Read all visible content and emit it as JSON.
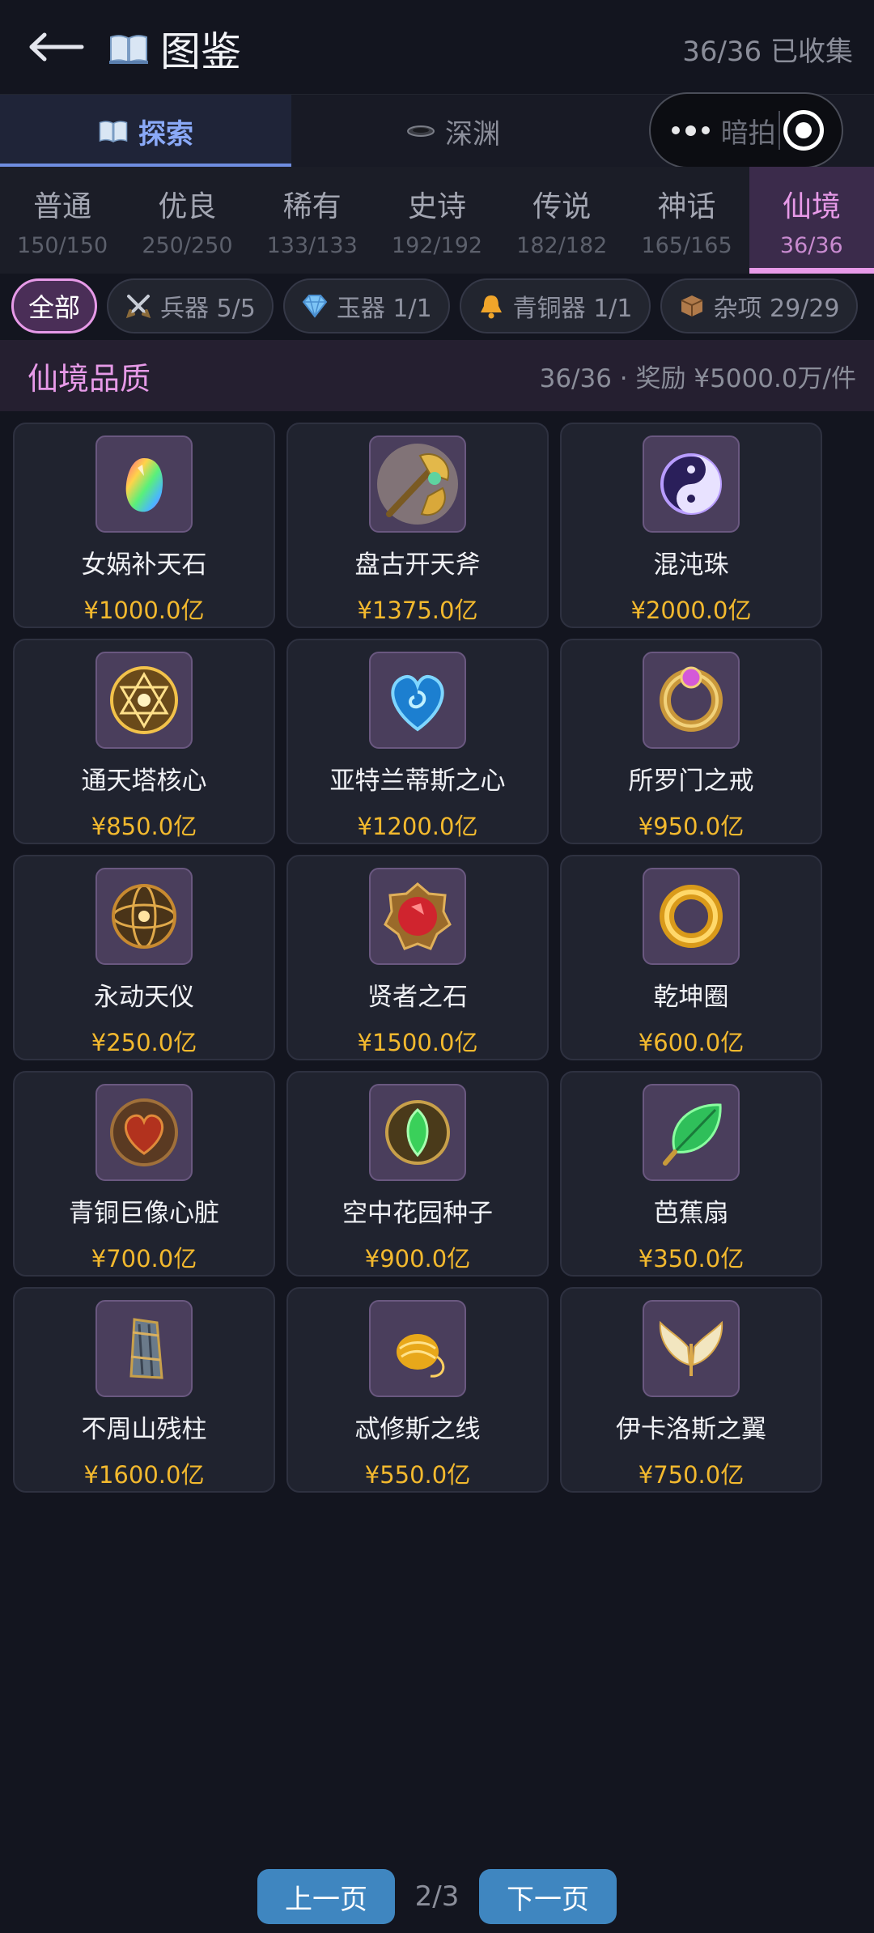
{
  "header": {
    "title": "图鉴",
    "collected": "36/36 已收集",
    "icons": {
      "back": "back-arrow-icon",
      "title": "book-icon"
    }
  },
  "tabs": [
    {
      "label": "探索",
      "active": true,
      "icon": "book-icon"
    },
    {
      "label": "深渊",
      "active": false,
      "icon": "abyss-disc-icon"
    }
  ],
  "capsule": {
    "label": "暗拍",
    "icons": [
      "more-dots-icon",
      "target-icon"
    ]
  },
  "rarities": [
    {
      "name": "普通",
      "count": "150/150",
      "active": false
    },
    {
      "name": "优良",
      "count": "250/250",
      "active": false
    },
    {
      "name": "稀有",
      "count": "133/133",
      "active": false
    },
    {
      "name": "史诗",
      "count": "192/192",
      "active": false
    },
    {
      "name": "传说",
      "count": "182/182",
      "active": false
    },
    {
      "name": "神话",
      "count": "165/165",
      "active": false
    },
    {
      "name": "仙境",
      "count": "36/36",
      "active": true
    }
  ],
  "chips": [
    {
      "label": "全部",
      "active": true,
      "icon": ""
    },
    {
      "label": "兵器 5/5",
      "active": false,
      "icon": "crossed-swords-icon"
    },
    {
      "label": "玉器 1/1",
      "active": false,
      "icon": "gem-icon"
    },
    {
      "label": "青铜器 1/1",
      "active": false,
      "icon": "bell-icon"
    },
    {
      "label": "杂项 29/29",
      "active": false,
      "icon": "box-icon"
    }
  ],
  "section": {
    "title": "仙境品质",
    "meta": "36/36 · 奖励 ¥5000.0万/件"
  },
  "items": [
    {
      "name": "女娲补天石",
      "price": "¥1000.0亿",
      "icon": "rainbow-stone-icon"
    },
    {
      "name": "盘古开天斧",
      "price": "¥1375.0亿",
      "icon": "golden-axe-icon"
    },
    {
      "name": "混沌珠",
      "price": "¥2000.0亿",
      "icon": "yin-yang-orb-icon"
    },
    {
      "name": "通天塔核心",
      "price": "¥850.0亿",
      "icon": "hexagram-core-icon"
    },
    {
      "name": "亚特兰蒂斯之心",
      "price": "¥1200.0亿",
      "icon": "blue-heart-icon"
    },
    {
      "name": "所罗门之戒",
      "price": "¥950.0亿",
      "icon": "ring-icon"
    },
    {
      "name": "永动天仪",
      "price": "¥250.0亿",
      "icon": "armillary-sphere-icon"
    },
    {
      "name": "贤者之石",
      "price": "¥1500.0亿",
      "icon": "red-stone-icon"
    },
    {
      "name": "乾坤圈",
      "price": "¥600.0亿",
      "icon": "golden-ring-icon"
    },
    {
      "name": "青铜巨像心脏",
      "price": "¥700.0亿",
      "icon": "bronze-heart-icon"
    },
    {
      "name": "空中花园种子",
      "price": "¥900.0亿",
      "icon": "green-seed-icon"
    },
    {
      "name": "芭蕉扇",
      "price": "¥350.0亿",
      "icon": "leaf-fan-icon"
    },
    {
      "name": "不周山残柱",
      "price": "¥1600.0亿",
      "icon": "pillar-icon"
    },
    {
      "name": "忒修斯之线",
      "price": "¥550.0亿",
      "icon": "golden-thread-icon"
    },
    {
      "name": "伊卡洛斯之翼",
      "price": "¥750.0亿",
      "icon": "wings-icon"
    }
  ],
  "pager": {
    "prev": "上一页",
    "info": "2/3",
    "next": "下一页"
  },
  "colors": {
    "accent": "#e79ae8",
    "price": "#f3b92e",
    "tab_active": "#8aa9f7",
    "button": "#3f86c0"
  }
}
